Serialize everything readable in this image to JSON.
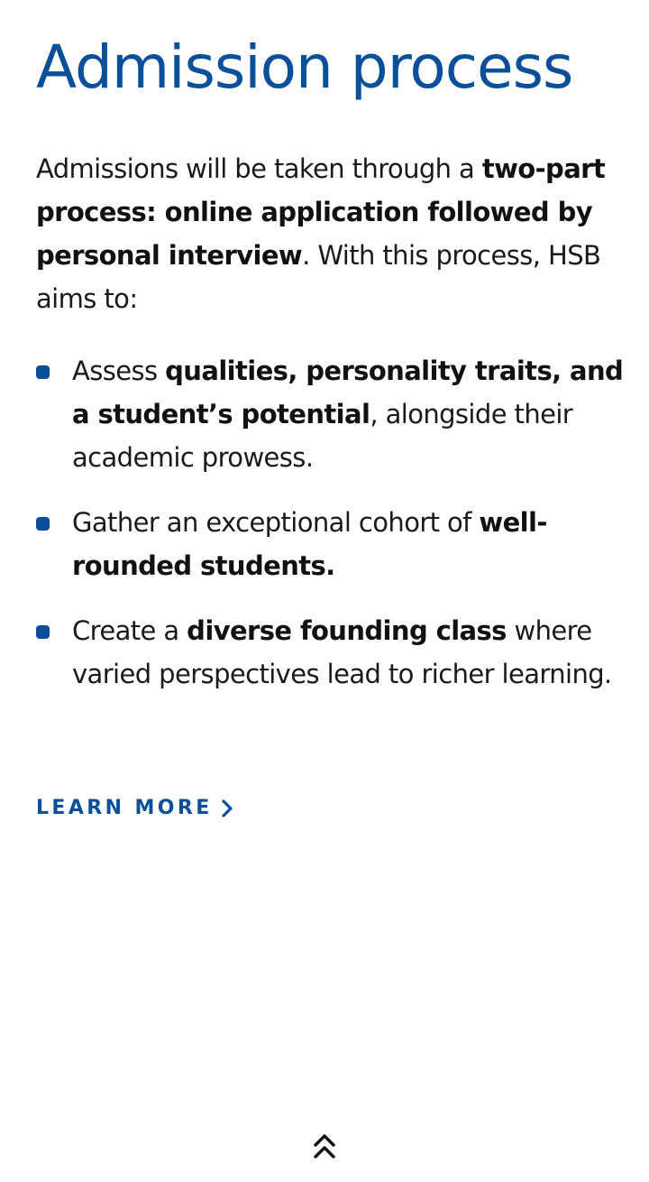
{
  "section": {
    "title": "Admission process",
    "intro": {
      "part1": "Admissions will be taken through a ",
      "bold1": "two-part process: online application followed by personal interview",
      "part2": ". With this process, HSB aims to:"
    },
    "bullets": [
      {
        "before": "Assess ",
        "bold": "qualities, personality traits, and a student’s potential",
        "after": ", alongside their academic prowess."
      },
      {
        "before": "Gather an exceptional cohort of ",
        "bold": "well-rounded students.",
        "after": ""
      },
      {
        "before": "Create a ",
        "bold": "diverse founding class",
        "after": " where varied perspectives lead to richer learning."
      }
    ],
    "learn_more_label": "LEARN MORE"
  },
  "icons": {
    "bullet": "square-bullet-icon",
    "learn_more": "chevron-right-icon",
    "scroll_top": "double-chevron-up-icon"
  },
  "colors": {
    "accent": "#0a4f9a",
    "text": "#1a1a1a",
    "background": "#ffffff"
  }
}
